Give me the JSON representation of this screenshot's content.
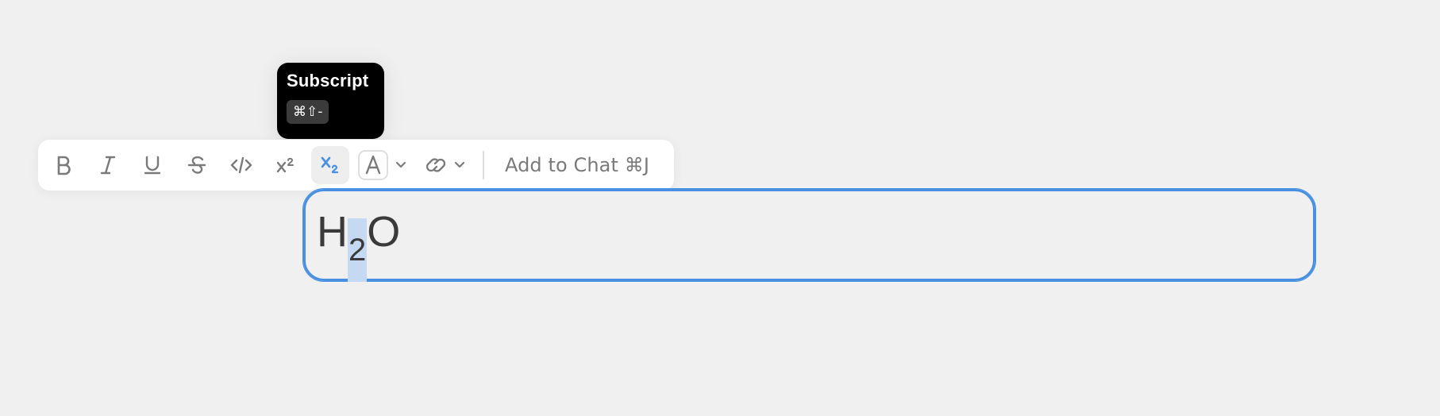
{
  "tooltip": {
    "title": "Subscript",
    "shortcut": "⌘⇧-"
  },
  "toolbar": {
    "buttons": [
      {
        "name": "bold",
        "icon": "bold-icon"
      },
      {
        "name": "italic",
        "icon": "italic-icon"
      },
      {
        "name": "underline",
        "icon": "underline-icon"
      },
      {
        "name": "strikethrough",
        "icon": "strikethrough-icon"
      },
      {
        "name": "code",
        "icon": "code-icon"
      },
      {
        "name": "superscript",
        "icon": "superscript-icon"
      },
      {
        "name": "subscript",
        "icon": "subscript-icon",
        "active": true
      },
      {
        "name": "text-color",
        "icon": "text-color-icon",
        "glyph": "A"
      },
      {
        "name": "link",
        "icon": "link-icon"
      }
    ],
    "add_to_chat_label": "Add to Chat ⌘J"
  },
  "editor": {
    "text_before": "H",
    "subscript_text": "2",
    "text_after": "O"
  },
  "colors": {
    "accent": "#4a90e2",
    "selection": "#c6d9f3",
    "icon": "#7a7a7a",
    "tooltip_bg": "#000000"
  }
}
